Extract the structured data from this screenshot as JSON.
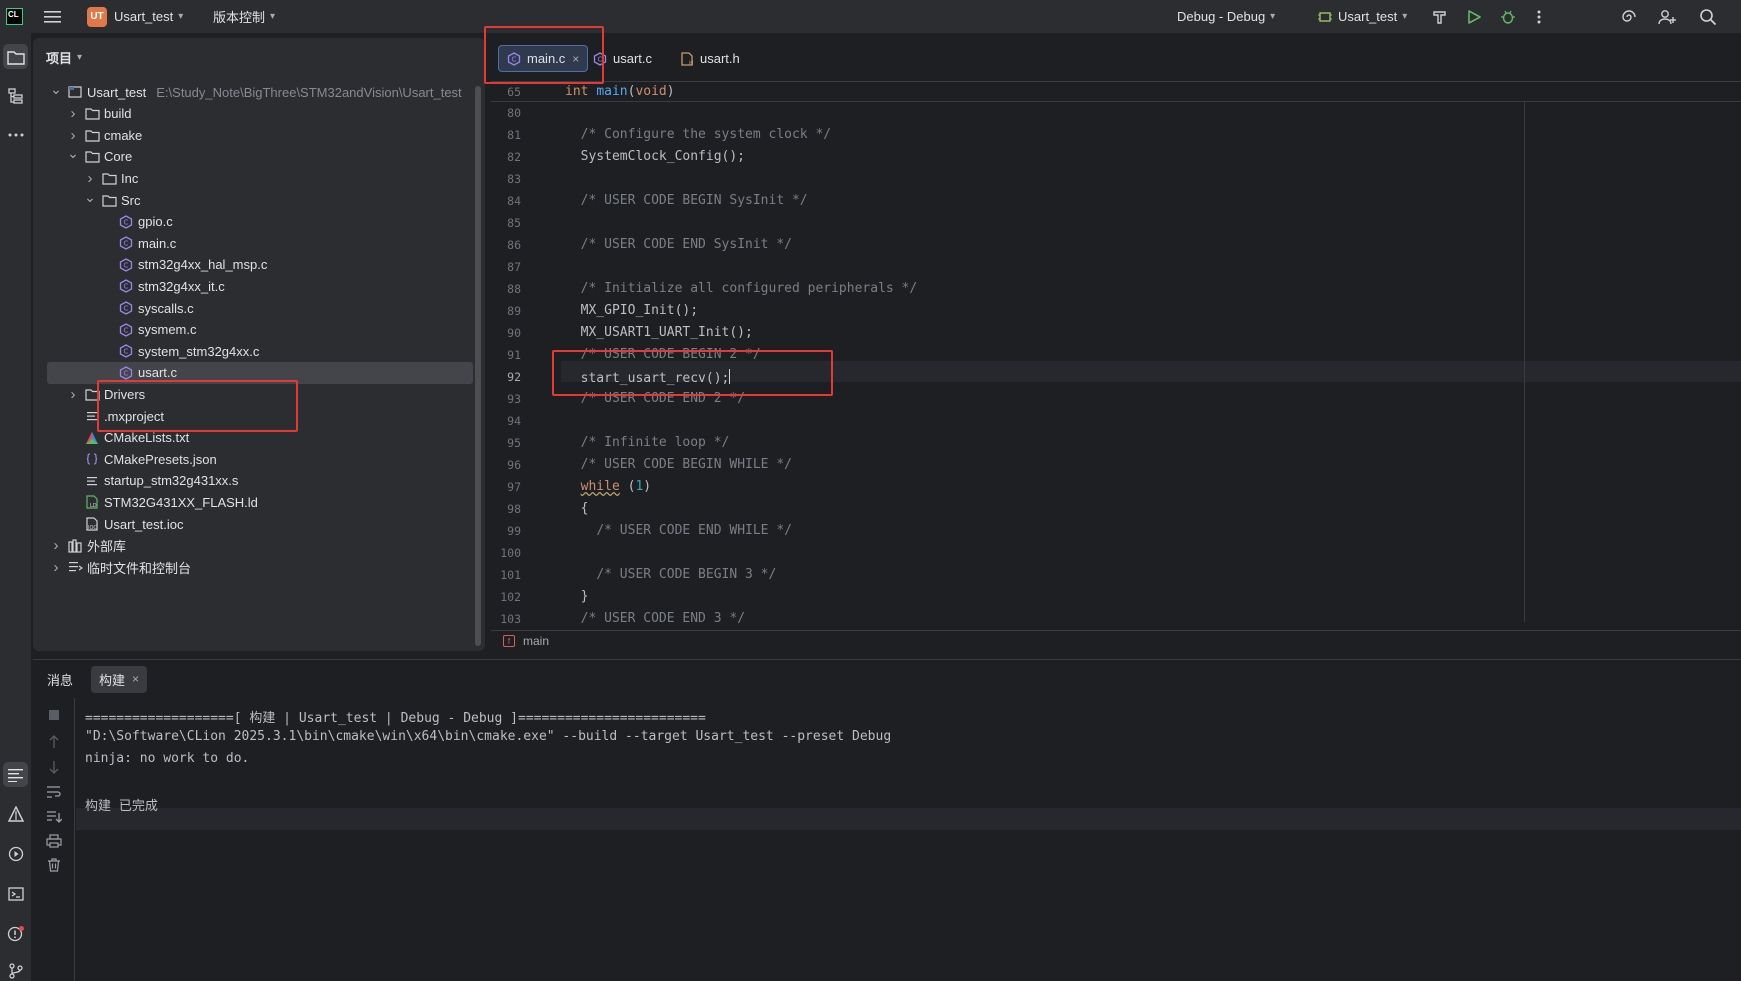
{
  "titlebar": {
    "logo": "CL",
    "project_badge": "UT",
    "project_name": "Usart_test",
    "vcs_label": "版本控制",
    "config_label": "Debug - Debug",
    "run_target": "Usart_test"
  },
  "project_panel": {
    "header": "项目",
    "tree": [
      {
        "label": "Usart_test",
        "path": "E:\\Study_Note\\BigThree\\STM32andVision\\Usart_test",
        "type": "project",
        "expanded": true
      },
      {
        "label": "build",
        "type": "folder"
      },
      {
        "label": "cmake",
        "type": "folder"
      },
      {
        "label": "Core",
        "type": "folder",
        "expanded": true
      },
      {
        "label": "Inc",
        "type": "folder"
      },
      {
        "label": "Src",
        "type": "folder",
        "expanded": true
      },
      {
        "label": "gpio.c",
        "type": "c-file"
      },
      {
        "label": "main.c",
        "type": "c-file"
      },
      {
        "label": "stm32g4xx_hal_msp.c",
        "type": "c-file"
      },
      {
        "label": "stm32g4xx_it.c",
        "type": "c-file"
      },
      {
        "label": "syscalls.c",
        "type": "c-file"
      },
      {
        "label": "sysmem.c",
        "type": "c-file"
      },
      {
        "label": "system_stm32g4xx.c",
        "type": "c-file"
      },
      {
        "label": "usart.c",
        "type": "c-file",
        "selected": true
      },
      {
        "label": "Drivers",
        "type": "folder"
      },
      {
        "label": ".mxproject",
        "type": "text-file"
      },
      {
        "label": "CMakeLists.txt",
        "type": "cmake-file"
      },
      {
        "label": "CMakePresets.json",
        "type": "json-file"
      },
      {
        "label": "startup_stm32g431xx.s",
        "type": "text-file"
      },
      {
        "label": "STM32G431XX_FLASH.ld",
        "type": "ld-file"
      },
      {
        "label": "Usart_test.ioc",
        "type": "ioc-file"
      },
      {
        "label": "外部库",
        "type": "library"
      },
      {
        "label": "临时文件和控制台",
        "type": "scratch"
      }
    ]
  },
  "editor": {
    "tabs": [
      {
        "label": "main.c",
        "active": true
      },
      {
        "label": "usart.c",
        "active": false
      },
      {
        "label": "usart.h",
        "active": false
      }
    ],
    "sticky_line_number": "65",
    "sticky_code": "int main(void)",
    "lines": [
      {
        "n": "80",
        "text": ""
      },
      {
        "n": "81",
        "text": "  /* Configure the system clock */"
      },
      {
        "n": "82",
        "text": "  SystemClock_Config();"
      },
      {
        "n": "83",
        "text": ""
      },
      {
        "n": "84",
        "text": "  /* USER CODE BEGIN SysInit */"
      },
      {
        "n": "85",
        "text": ""
      },
      {
        "n": "86",
        "text": "  /* USER CODE END SysInit */"
      },
      {
        "n": "87",
        "text": ""
      },
      {
        "n": "88",
        "text": "  /* Initialize all configured peripherals */"
      },
      {
        "n": "89",
        "text": "  MX_GPIO_Init();"
      },
      {
        "n": "90",
        "text": "  MX_USART1_UART_Init();"
      },
      {
        "n": "91",
        "text": "  /* USER CODE BEGIN 2 */"
      },
      {
        "n": "92",
        "text": "  start_usart_recv();"
      },
      {
        "n": "93",
        "text": "  /* USER CODE END 2 */"
      },
      {
        "n": "94",
        "text": ""
      },
      {
        "n": "95",
        "text": "  /* Infinite loop */"
      },
      {
        "n": "96",
        "text": "  /* USER CODE BEGIN WHILE */"
      },
      {
        "n": "97",
        "text": "  while (1)"
      },
      {
        "n": "98",
        "text": "  {"
      },
      {
        "n": "99",
        "text": "    /* USER CODE END WHILE */"
      },
      {
        "n": "100",
        "text": ""
      },
      {
        "n": "101",
        "text": "    /* USER CODE BEGIN 3 */"
      },
      {
        "n": "102",
        "text": "  }"
      },
      {
        "n": "103",
        "text": "  /* USER CODE END 3 */"
      }
    ],
    "breadcrumb": "main"
  },
  "bottom_panel": {
    "tab_messages": "消息",
    "tab_build": "构建",
    "console_lines": [
      "===================[ 构建 | Usart_test | Debug - Debug ]========================",
      "\"D:\\Software\\CLion 2025.3.1\\bin\\cmake\\win\\x64\\bin\\cmake.exe\" --build --target Usart_test --preset Debug",
      "ninja: no work to do.",
      "",
      "构建 已完成"
    ]
  },
  "colors": {
    "highlight": "#e53935",
    "accent": "#4d6fa5",
    "badge": "#e0784a"
  }
}
